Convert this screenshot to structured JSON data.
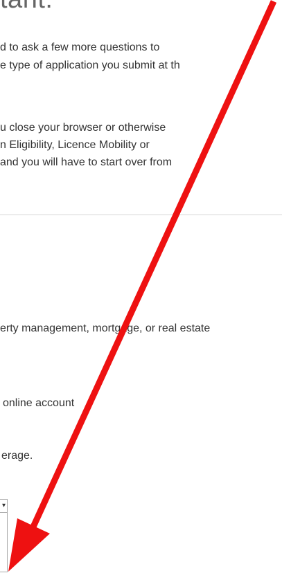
{
  "heading": "tant.",
  "intro_paragraph": [
    "d to ask a few more questions to",
    "e type of application you submit at th"
  ],
  "warning_paragraph": [
    "u close your browser or otherwise",
    "n Eligibility, Licence Mobility or",
    "and you will have to start over from"
  ],
  "options": [
    "erty management, mortgage, or real estate",
    "online account",
    "erage."
  ],
  "annotation": {
    "arrow_color": "#ee1111"
  }
}
